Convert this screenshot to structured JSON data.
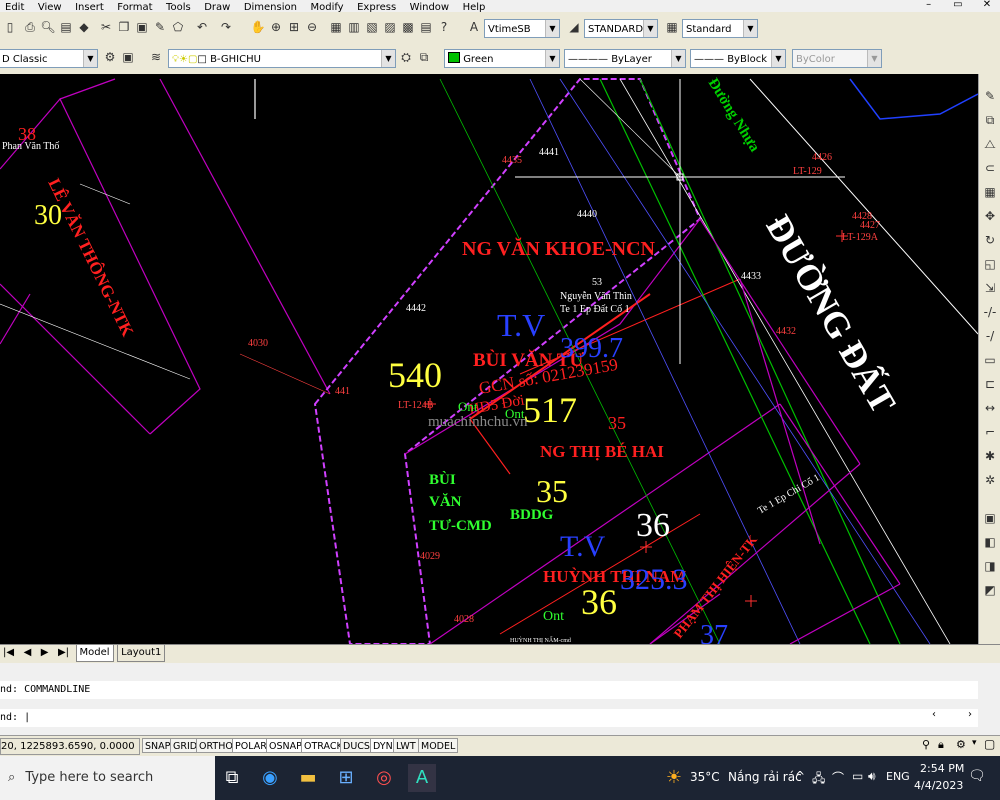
{
  "menubar": {
    "items": [
      "Edit",
      "View",
      "Insert",
      "Format",
      "Tools",
      "Draw",
      "Dimension",
      "Modify",
      "Express",
      "Window",
      "Help"
    ]
  },
  "window_controls": {
    "minimize": "–",
    "restore": "▭",
    "close": "✕"
  },
  "toolbar1": {
    "text_style": "VtimeSB",
    "dim_style": "STANDARD",
    "table_style": "Standard"
  },
  "toolbar2": {
    "workspace": "D Classic",
    "layer": "B-GHICHU",
    "color": "Green",
    "linetype": "ByLayer",
    "lineweight": "ByBlock",
    "plotstyle": "ByColor"
  },
  "drawing": {
    "labels": {
      "ng_van_khoe": "NG VĂN KHOE-NCN",
      "bui_van_tu": "BÙI VĂN TƯ",
      "bui_van_tu_cmd_1": "BÙI",
      "bui_van_tu_cmd_2": "VĂN",
      "bui_van_tu_cmd_3": "TƯ-CMD",
      "gcn": "GCN số: 021239159",
      "hd": "HD5 Đời",
      "ng_thi_be_hai": "NG THỊ BÉ HAI",
      "huynh_thi_nam": "HUỲNH THỊ NAM",
      "le_van_thong": "LÊ VĂN THÔNG-NTK",
      "pham_thi": "PHẠM THỊ HIỆN-TK",
      "duong_dat": "ĐƯỜNG ĐẤT",
      "duong_nhua": "Đường Nhựa",
      "bddg": "BDDG",
      "ont1": "Ont",
      "ont2": "Ont",
      "ont3": "Ont",
      "p540": "540",
      "p517": "517",
      "p35": "35",
      "p36": "36",
      "p36b": "36",
      "p30": "30",
      "p38": "38",
      "p35_red": "35",
      "watermark": "muachinhchu.vn",
      "n4441": "4441",
      "n4435": "4435",
      "n4440": "4440",
      "n4442": "4442",
      "n4433": "4433",
      "n4432": "4432",
      "n4426": "4426",
      "n4428": "4428",
      "n4427": "4427",
      "n4030": "4030",
      "n4041": "441",
      "n4029": "4029",
      "n4028": "4028",
      "lt129": "LT-129",
      "lt129a": "LT-129A",
      "lt124b": "LT-124B",
      "owner_small1": "Nguyễn Văn Thìn",
      "owner_small2": "Te 1 Ep Đất Cố 1",
      "owner_small3": "Phan Văn Thố",
      "owner_small4": "Te 1 Ep Chỉ Cố 1",
      "n53": "53",
      "tv1": "T.V",
      "tv2": "T.V",
      "area1": "399.7",
      "area2": "325.3",
      "area3": "37",
      "sm1": "HUỲNH THỊ NẤM-cmd"
    }
  },
  "tabs": {
    "model": "Model",
    "layout1": "Layout1"
  },
  "command": {
    "history": "nd: COMMANDLINE",
    "prompt": "nd:"
  },
  "status": {
    "coords": "20, 1225893.6590, 0.0000",
    "buttons": [
      "SNAP",
      "GRID",
      "ORTHO",
      "POLAR",
      "OSNAP",
      "OTRACK",
      "DUCS",
      "DYN",
      "LWT",
      "MODEL"
    ]
  },
  "taskbar": {
    "search_placeholder": "Type here to search",
    "weather_temp": "35°C",
    "weather_text": "Nắng rải rác",
    "lang": "ENG",
    "time": "2:54 PM",
    "date": "4/4/2023"
  }
}
